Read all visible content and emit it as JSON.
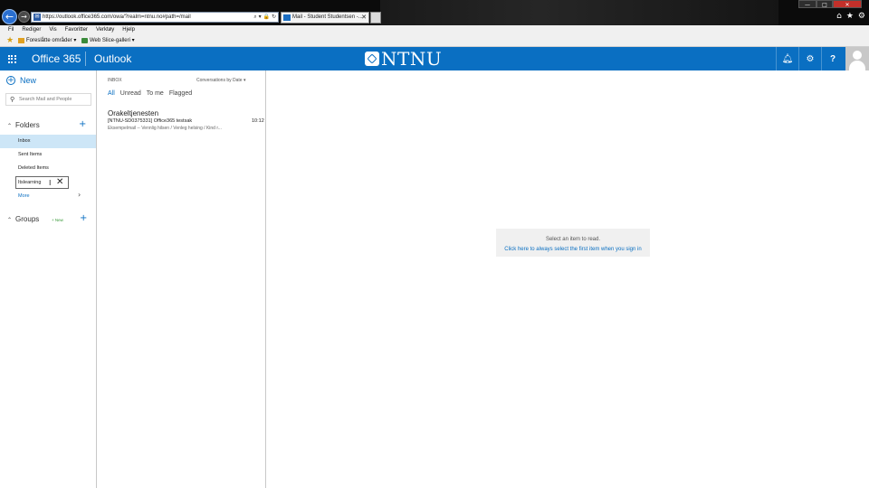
{
  "browser": {
    "url": "https://outlook.office365.com/owa/?realm=ntnu.no#path=/mail",
    "tab_title": "Mail - Student Studentsen -...",
    "tab_close": "✕",
    "win_min": "—",
    "win_max": "□",
    "win_close": "✕",
    "menu": [
      "Fil",
      "Rediger",
      "Vis",
      "Favoritter",
      "Verktøy",
      "Hjelp"
    ],
    "favorites": [
      "Foreslåtte områder ▾",
      "Web Slice-galleri ▾"
    ]
  },
  "header": {
    "brand": "Office 365",
    "app": "Outlook",
    "logo_text": "NTNU",
    "accent": "#0a6fc2"
  },
  "leftpane": {
    "new_label": "New",
    "search_placeholder": "Search Mail and People",
    "folders_label": "Folders",
    "folders": [
      "Inbox",
      "Sent Items",
      "Deleted Items"
    ],
    "rename_value": "Itslearning",
    "more_label": "More",
    "groups_label": "Groups",
    "groups_new": "+ New"
  },
  "list": {
    "folder_label": "INBOX",
    "sort_label": "Conversations by Date ▾",
    "filters": [
      "All",
      "Unread",
      "To me",
      "Flagged"
    ],
    "messages": [
      {
        "sender": "Orakeltjenesten",
        "subject": "[NTNU-SD0375331] Office365 testsak",
        "time": "10:12",
        "preview": "Eksempelmail -- Vennlig hilsen / Venleg helsing / Kind r..."
      }
    ]
  },
  "reading": {
    "placeholder": "Select an item to read.",
    "link": "Click here to always select the first item when you sign in"
  }
}
